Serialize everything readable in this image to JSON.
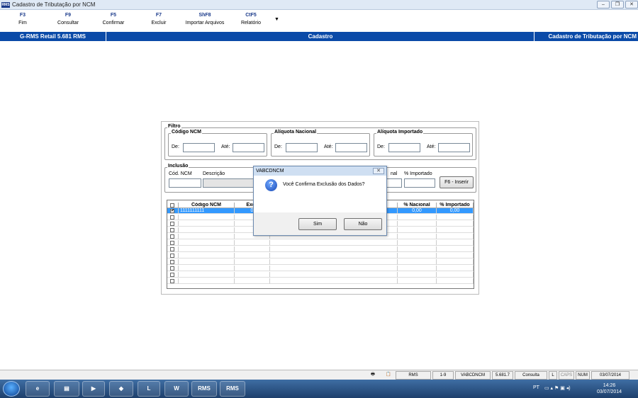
{
  "window": {
    "title": "Cadastro de Tributação por NCM",
    "app_icon": "RMS"
  },
  "toolbar": [
    {
      "key": "F3",
      "label": "Fim"
    },
    {
      "key": "F9",
      "label": "Consultar"
    },
    {
      "key": "F5",
      "label": "Confirmar"
    },
    {
      "key": "F7",
      "label": "Excluir"
    },
    {
      "key": "ShF8",
      "label": "Importar Arquivos"
    },
    {
      "key": "CtF5",
      "label": "Relatório"
    }
  ],
  "bluebar": {
    "left": "G-RMS Retail 5.681 RMS",
    "center": "Cadastro",
    "right": "Cadastro de Tributação por NCM"
  },
  "filtro": {
    "title": "Filtro",
    "codigo_ncm": {
      "title": "Código NCM",
      "de": "De:",
      "ate": "Até:"
    },
    "aliquota_nacional": {
      "title": "Alíquota Nacional",
      "de": "De:",
      "ate": "Até:"
    },
    "aliquota_importado": {
      "title": "Alíquota Importado",
      "de": "De:",
      "ate": "Até:"
    }
  },
  "inclusao": {
    "title": "Inclusão",
    "cod_ncm_label": "Cód. NCM",
    "descricao_label": "Descrição",
    "nacional_label": "nal",
    "importado_label": "% Importado",
    "insert_button": "F6 - Inserir"
  },
  "grid": {
    "headers": [
      "",
      "Código NCM",
      "Exce",
      "",
      "% Nacional",
      "% Importado"
    ],
    "rows": [
      {
        "checked": true,
        "codigo": "1111111111",
        "excecao": "0",
        "nacional": "0,00",
        "importado": "0,00"
      },
      {
        "checked": false
      },
      {
        "checked": false
      },
      {
        "checked": false
      },
      {
        "checked": false
      },
      {
        "checked": false
      },
      {
        "checked": false
      },
      {
        "checked": false
      },
      {
        "checked": false
      },
      {
        "checked": false
      },
      {
        "checked": false
      },
      {
        "checked": false
      }
    ]
  },
  "dialog": {
    "title": "VABCDNCM",
    "message": "Você Confirma Exclusão dos Dados?",
    "yes": "Sim",
    "no": "Não",
    "icon": "question-icon"
  },
  "statusbar": {
    "app": "RMS",
    "pages": "1-9",
    "program": "VABCDNCM",
    "version": "5.681.7",
    "mode": "Consulta",
    "l": "L",
    "caps": "CAPS",
    "num": "NUM",
    "date": "03/07/2014"
  },
  "taskbar": {
    "apps": [
      "RMS",
      "RMS"
    ],
    "lang": "PT",
    "time": "14:26",
    "date": "03/07/2014"
  }
}
